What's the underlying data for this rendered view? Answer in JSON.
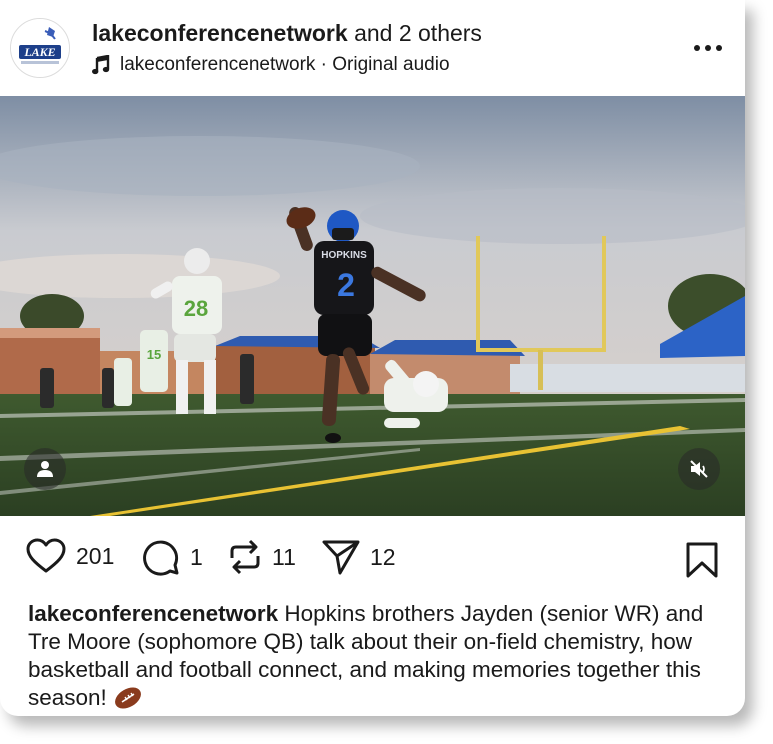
{
  "post": {
    "author": "lakeconferencenetwork",
    "coauthors": "and 2 others",
    "audio": "lakeconferencenetwork · Original audio",
    "avatar_text": "LAKE"
  },
  "media": {
    "jersey_text": "HOPKINS",
    "jersey_number": "2",
    "opponent_number": "28",
    "opponent2_number": "15"
  },
  "actions": {
    "likes": "201",
    "comments": "1",
    "reposts": "11",
    "shares": "12"
  },
  "caption": {
    "username": "lakeconferencenetwork",
    "text": " Hopkins brothers Jayden (senior WR) and Tre Moore (sophomore QB) talk about their on-field chemistry, how basketball and football connect, and making memories together this season! "
  },
  "icons": {
    "like": "heart-icon",
    "comment": "comment-icon",
    "repost": "repost-icon",
    "share": "send-icon",
    "save": "bookmark-icon",
    "more": "more-icon",
    "audio": "music-note-icon",
    "mute": "muted-speaker-icon",
    "tagged": "user-icon"
  }
}
